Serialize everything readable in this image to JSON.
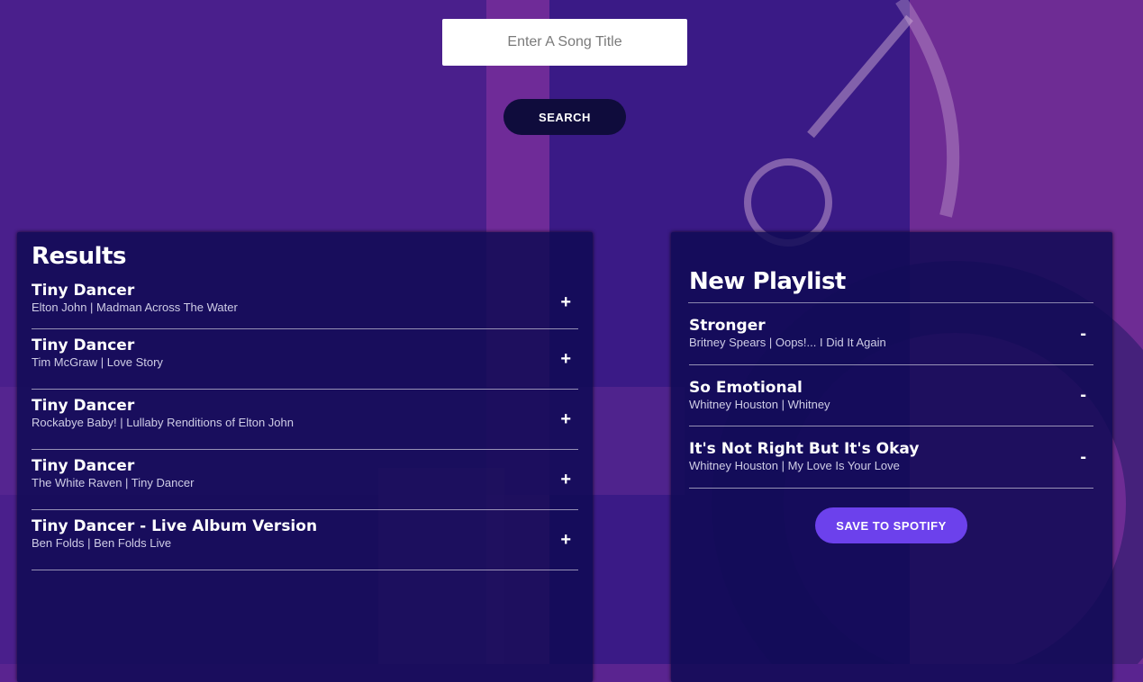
{
  "search": {
    "placeholder": "Enter A Song Title",
    "value": "",
    "button_label": "SEARCH"
  },
  "results": {
    "title": "Results",
    "action_symbol": "+",
    "tracks": [
      {
        "name": "Tiny Dancer",
        "info": "Elton John | Madman Across The Water"
      },
      {
        "name": "Tiny Dancer",
        "info": "Tim McGraw | Love Story"
      },
      {
        "name": "Tiny Dancer",
        "info": "Rockabye Baby! | Lullaby Renditions of Elton John"
      },
      {
        "name": "Tiny Dancer",
        "info": "The White Raven | Tiny Dancer"
      },
      {
        "name": "Tiny Dancer - Live Album Version",
        "info": "Ben Folds | Ben Folds Live"
      }
    ]
  },
  "playlist": {
    "title": "New Playlist",
    "action_symbol": "-",
    "tracks": [
      {
        "name": "Stronger",
        "info": "Britney Spears | Oops!... I Did It Again"
      },
      {
        "name": "So Emotional",
        "info": "Whitney Houston | Whitney"
      },
      {
        "name": "It's Not Right But It's Okay",
        "info": "Whitney Houston | My Love Is Your Love"
      }
    ],
    "save_label": "SAVE TO SPOTIFY"
  },
  "colors": {
    "background": "#5a2490",
    "panel": "#0e0a54",
    "search_button": "#0f0c3c",
    "save_button": "#6c41ec",
    "text": "#ffffff",
    "subtext": "#cfcde6"
  }
}
